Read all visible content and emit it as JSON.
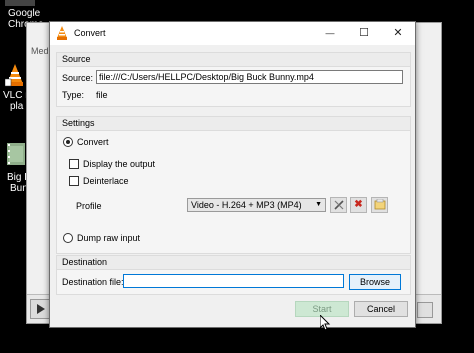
{
  "desktop": {
    "chrome_label_line1": "Google",
    "chrome_label_line2": "Chrome",
    "vlc_label_line1": "VLC m",
    "vlc_label_line2": "pla",
    "movie_label_line1": "Big B",
    "movie_label_line2": "Bun"
  },
  "vlc_main": {
    "tab_label": "Med"
  },
  "dialog": {
    "title": "Convert",
    "minimize_glyph": "—",
    "maximize_glyph": "☐",
    "close_glyph": "✕",
    "source": {
      "group_title": "Source",
      "source_label": "Source:",
      "source_value": "file:///C:/Users/HELLPC/Desktop/Big Buck Bunny.mp4",
      "type_label": "Type:",
      "type_value": "file"
    },
    "settings": {
      "group_title": "Settings",
      "convert_label": "Convert",
      "display_output_label": "Display the output",
      "deinterlace_label": "Deinterlace",
      "profile_label": "Profile",
      "profile_selected": "Video - H.264 + MP3 (MP4)",
      "dump_raw_label": "Dump raw input"
    },
    "destination": {
      "group_title": "Destination",
      "file_label": "Destination file:",
      "file_value": "",
      "browse_label": "Browse"
    },
    "start_label": "Start",
    "cancel_label": "Cancel"
  }
}
